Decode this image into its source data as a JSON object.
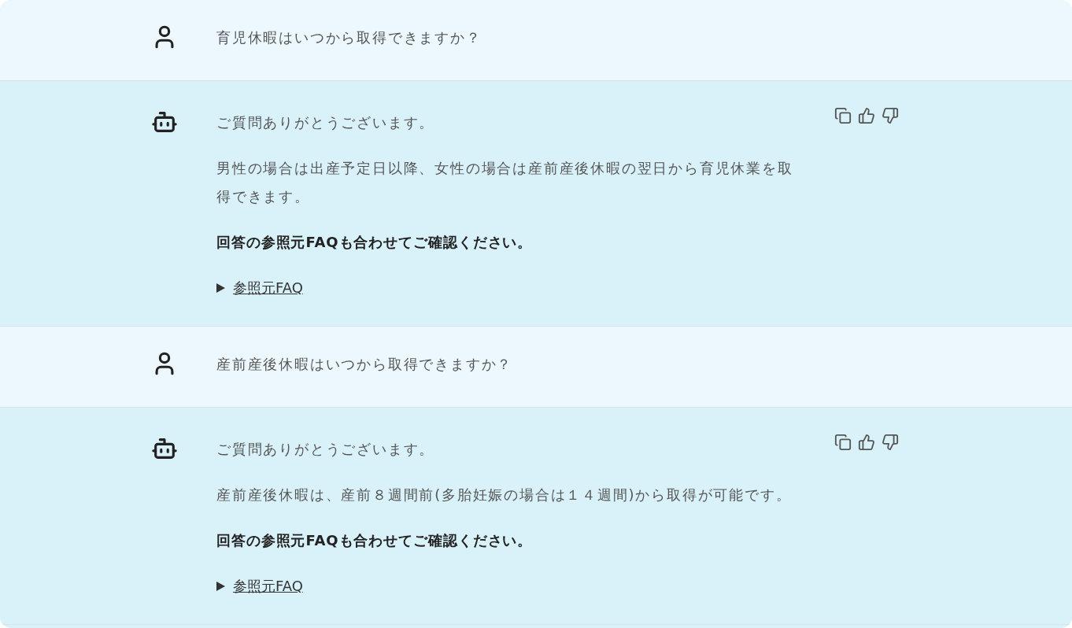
{
  "messages": [
    {
      "kind": "user",
      "text": "育児休暇はいつから取得できますか？"
    },
    {
      "kind": "bot",
      "paragraphs": [
        "ご質問ありがとうございます。",
        "男性の場合は出産予定日以降、女性の場合は産前産後休暇の翌日から育児休業を取得できます。"
      ],
      "note": "回答の参照元FAQも合わせてご確認ください。",
      "faq_link": "参照元FAQ"
    },
    {
      "kind": "user",
      "text": "産前産後休暇はいつから取得できますか？"
    },
    {
      "kind": "bot",
      "paragraphs": [
        "ご質問ありがとうございます。",
        "産前産後休暇は、産前８週間前(多胎妊娠の場合は１４週間)から取得が可能です。"
      ],
      "note": "回答の参照元FAQも合わせてご確認ください。",
      "faq_link": "参照元FAQ"
    }
  ]
}
